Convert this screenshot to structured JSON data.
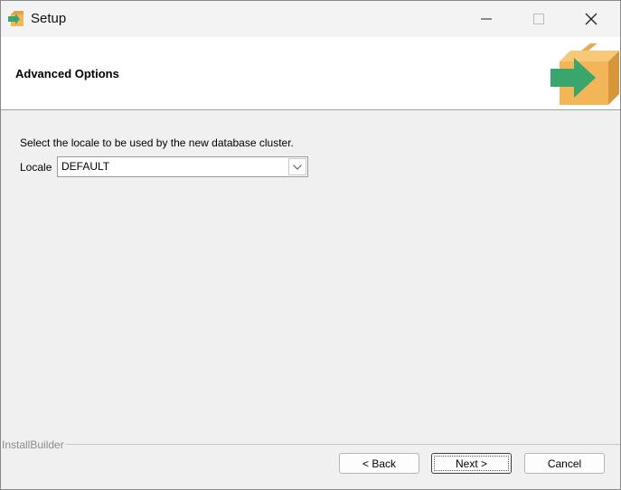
{
  "window": {
    "title": "Setup",
    "controls": [
      "minimize-icon",
      "maximize-icon",
      "close-icon"
    ]
  },
  "header": {
    "title": "Advanced Options",
    "logo_icon": "installer-box-arrow-icon"
  },
  "content": {
    "description": "Select the locale to be used by the new database cluster.",
    "locale": {
      "label": "Locale",
      "value": "DEFAULT"
    }
  },
  "footer": {
    "brand": "InstallBuilder",
    "back_label": "< Back",
    "next_label": "Next >",
    "cancel_label": "Cancel"
  },
  "colors": {
    "box_orange": "#f2b558",
    "box_dark": "#d8963a",
    "arrow_green": "#3aa66e"
  }
}
